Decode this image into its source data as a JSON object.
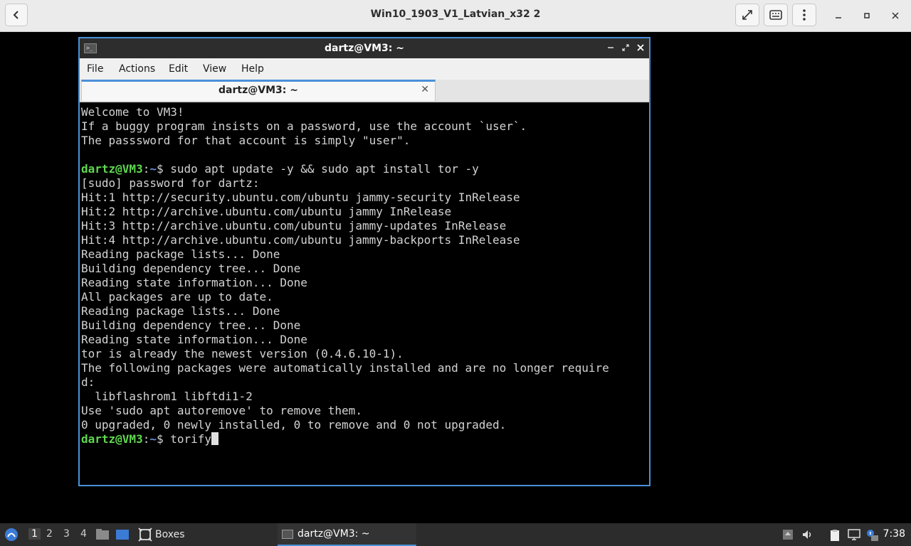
{
  "boxes": {
    "title": "Win10_1903_V1_Latvian_x32 2"
  },
  "terminal": {
    "window_title": "dartz@VM3: ~",
    "tab_label": "dartz@VM3: ~",
    "menu": [
      "File",
      "Actions",
      "Edit",
      "View",
      "Help"
    ],
    "lines": [
      "Welcome to VM3!",
      "If a buggy program insists on a password, use the account `user`.",
      "The passsword for that account is simply \"user\".",
      "",
      "PROMPT sudo apt update -y && sudo apt install tor -y",
      "[sudo] password for dartz:",
      "Hit:1 http://security.ubuntu.com/ubuntu jammy-security InRelease",
      "Hit:2 http://archive.ubuntu.com/ubuntu jammy InRelease",
      "Hit:3 http://archive.ubuntu.com/ubuntu jammy-updates InRelease",
      "Hit:4 http://archive.ubuntu.com/ubuntu jammy-backports InRelease",
      "Reading package lists... Done",
      "Building dependency tree... Done",
      "Reading state information... Done",
      "All packages are up to date.",
      "Reading package lists... Done",
      "Building dependency tree... Done",
      "Reading state information... Done",
      "tor is already the newest version (0.4.6.10-1).",
      "The following packages were automatically installed and are no longer require",
      "d:",
      "  libflashrom1 libftdi1-2",
      "Use 'sudo apt autoremove' to remove them.",
      "0 upgraded, 0 newly installed, 0 to remove and 0 not upgraded.",
      "PROMPT torify"
    ],
    "prompt_user": "dartz@VM3",
    "prompt_sep": ":",
    "prompt_path": "~",
    "prompt_dollar": "$ "
  },
  "taskbar": {
    "workspaces": [
      "1",
      "2",
      "3",
      "4"
    ],
    "active_workspace": "1",
    "boxes_label": "Boxes",
    "terminal_task_label": "dartz@VM3: ~",
    "clock": "7:38"
  },
  "colors": {
    "accent": "#4a90d9",
    "prompt_user": "#5fd74f",
    "prompt_path": "#6b8fd6"
  }
}
